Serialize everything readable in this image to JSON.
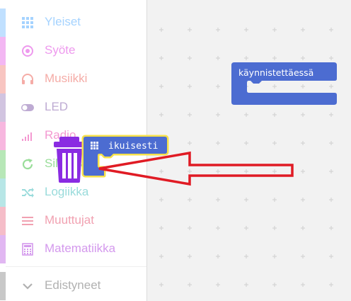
{
  "toolbox": {
    "categories": [
      {
        "label": "Yleiset",
        "icon": "grid-icon",
        "color": "#1e90ff"
      },
      {
        "label": "Syöte",
        "icon": "target-icon",
        "color": "#d400d4"
      },
      {
        "label": "Musiikki",
        "icon": "headphones-icon",
        "color": "#e63022"
      },
      {
        "label": "LED",
        "icon": "toggle-icon",
        "color": "#5c2d91"
      },
      {
        "label": "Radio",
        "icon": "signal-icon",
        "color": "#e3008c"
      },
      {
        "label": "Silmukat",
        "icon": "loop-icon",
        "color": "#00aa00"
      },
      {
        "label": "Logiikka",
        "icon": "shuffle-icon",
        "color": "#00a4a6"
      },
      {
        "label": "Muuttujat",
        "icon": "lines-icon",
        "color": "#dc143c"
      },
      {
        "label": "Matematiikka",
        "icon": "calculator-icon",
        "color": "#9400d3"
      }
    ],
    "advanced": {
      "label": "Edistyneet",
      "icon": "chevron-down-icon",
      "color": "#3c3c3c"
    }
  },
  "workspace": {
    "on_start_block": {
      "label": "käynnistettäessä",
      "color": "#4c6cd1"
    },
    "forever_block": {
      "label": "ikuisesti",
      "color": "#4c6cd1",
      "highlight": "#f5e04a"
    },
    "trash_icon": {
      "name": "trash-icon",
      "color": "#8a2be2"
    },
    "annotation_arrow_color": "#e01b24"
  }
}
